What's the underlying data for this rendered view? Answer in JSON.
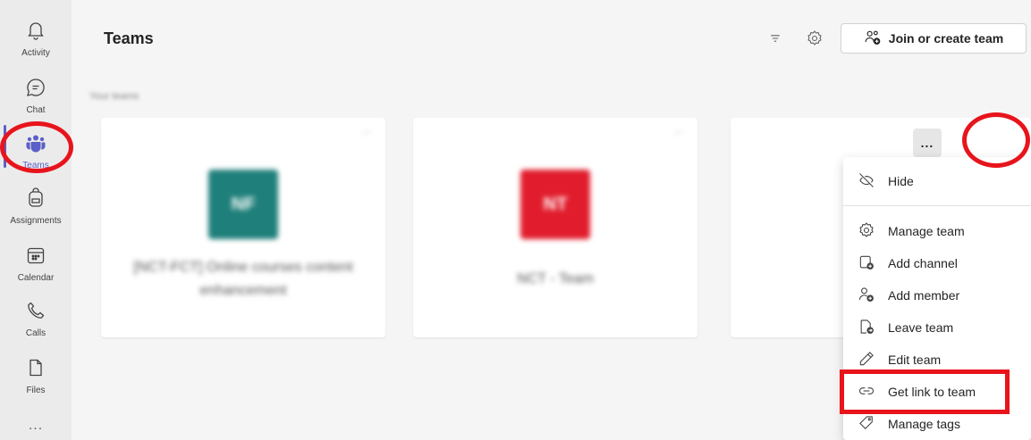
{
  "rail": {
    "items": [
      {
        "label": "Activity",
        "icon": "bell-icon"
      },
      {
        "label": "Chat",
        "icon": "chat-icon"
      },
      {
        "label": "Teams",
        "icon": "teams-icon"
      },
      {
        "label": "Assignments",
        "icon": "backpack-icon"
      },
      {
        "label": "Calendar",
        "icon": "calendar-icon"
      },
      {
        "label": "Calls",
        "icon": "phone-icon"
      },
      {
        "label": "Files",
        "icon": "file-icon"
      }
    ],
    "more": "..."
  },
  "header": {
    "title": "Teams",
    "join_label": "Join or create team"
  },
  "section": {
    "label": "Your teams"
  },
  "cards": [
    {
      "name": "[NCT-FCT] Online courses content enhancement",
      "avatar_text": "NF",
      "avatar_color": "#1f7f7a"
    },
    {
      "name": "NCT - Team",
      "avatar_text": "NT",
      "avatar_color": "#e11d2d"
    }
  ],
  "more_button": {
    "label": "..."
  },
  "menu": {
    "items": [
      {
        "label": "Hide",
        "icon": "hide-icon"
      },
      {
        "label": "Manage team",
        "icon": "gear-icon"
      },
      {
        "label": "Add channel",
        "icon": "add-channel-icon"
      },
      {
        "label": "Add member",
        "icon": "add-member-icon"
      },
      {
        "label": "Leave team",
        "icon": "leave-icon"
      },
      {
        "label": "Edit team",
        "icon": "pencil-icon"
      },
      {
        "label": "Get link to team",
        "icon": "link-icon"
      },
      {
        "label": "Manage tags",
        "icon": "tag-icon"
      }
    ]
  },
  "colors": {
    "accent": "#5b5fc7",
    "annotation": "#e8141c"
  }
}
